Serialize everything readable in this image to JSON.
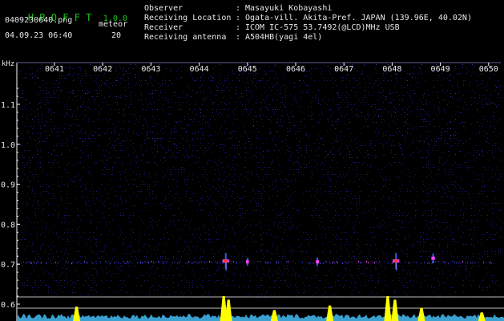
{
  "header": {
    "app_name": "H R O F F T",
    "version": "1.0.0",
    "filename": "0409230640.png",
    "datetime": "04.09.23 06:40",
    "meteor_label": "meteor",
    "meteor_count": "20"
  },
  "info": [
    {
      "key": "Observer",
      "value": "Masayuki Kobayashi"
    },
    {
      "key": "Receiving Location",
      "value": "Ogata-vill. Akita-Pref. JAPAN (139.96E, 40.02N)"
    },
    {
      "key": "Receiver",
      "value": "ICOM IC-575 53.7492(@LCD)MHz USB"
    },
    {
      "key": "Receiving antenna",
      "value": "A504HB(yagi 4el)"
    }
  ],
  "colors": {
    "title_green": "#19c519",
    "text": "#e8e8e8",
    "axis": "#ffffff",
    "background_noise": "#1a1a7a",
    "signal_hot": "#ff3030",
    "level_fill": "#ffff00",
    "level_base": "#3aa0d0"
  },
  "chart_data": {
    "type": "heatmap",
    "ylabel": "kHz",
    "x_ticks": [
      "0641",
      "0642",
      "0643",
      "0644",
      "0645",
      "0646",
      "0647",
      "0648",
      "0649",
      "0650"
    ],
    "x_values": [
      641,
      642,
      643,
      644,
      645,
      646,
      647,
      648,
      649,
      650
    ],
    "y_ticks": [
      "1.1",
      "1.0",
      "0.9",
      "0.8",
      "0.7",
      "0.6"
    ],
    "y_values": [
      1.1,
      1.0,
      0.9,
      0.8,
      0.7,
      0.6
    ],
    "ylim": [
      0.58,
      1.17
    ],
    "signal_band_khz": 0.706,
    "meteor_events": [
      {
        "time": 644.55,
        "freq": 0.708,
        "strength": 1.0
      },
      {
        "time": 648.08,
        "freq": 0.708,
        "strength": 1.0
      },
      {
        "time": 648.85,
        "freq": 0.715,
        "strength": 0.4
      },
      {
        "time": 646.45,
        "freq": 0.706,
        "strength": 0.3
      },
      {
        "time": 645.0,
        "freq": 0.706,
        "strength": 0.25
      }
    ],
    "level_spikes": [
      {
        "time": 641.45,
        "level": 0.55
      },
      {
        "time": 644.5,
        "level": 1.0
      },
      {
        "time": 644.6,
        "level": 0.85
      },
      {
        "time": 645.55,
        "level": 0.4
      },
      {
        "time": 646.7,
        "level": 0.6
      },
      {
        "time": 647.9,
        "level": 1.0
      },
      {
        "time": 648.05,
        "level": 0.85
      },
      {
        "time": 648.6,
        "level": 0.5
      },
      {
        "time": 649.85,
        "level": 0.3
      }
    ]
  }
}
